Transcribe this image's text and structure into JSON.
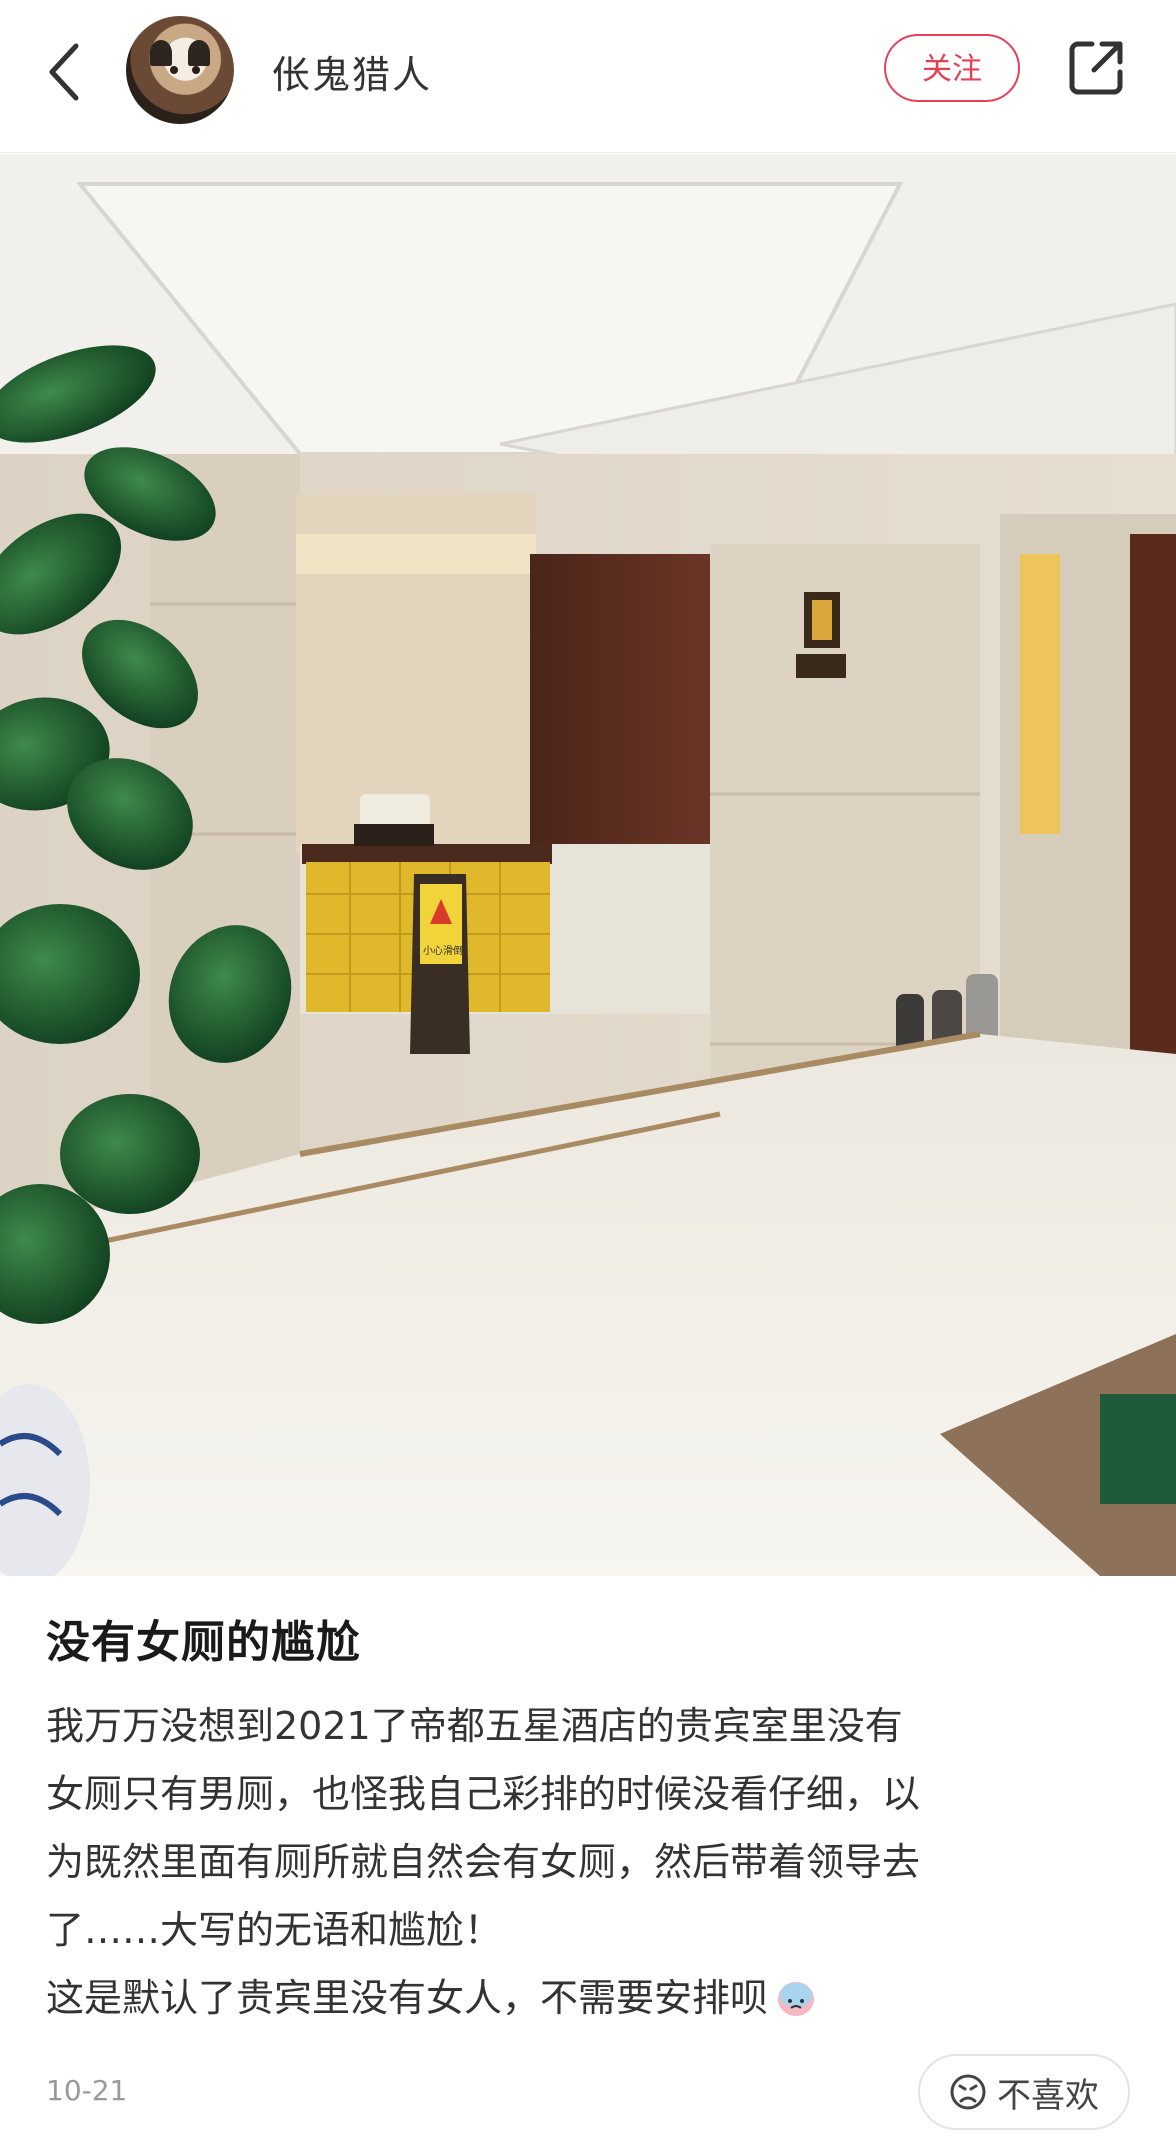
{
  "header": {
    "username": "伥鬼猎人",
    "follow_label": "关注"
  },
  "photo": {
    "sign_text": "小心滑倒"
  },
  "post": {
    "title": "没有女厕的尴尬",
    "body": "我万万没想到2021了帝都五星酒店的贵宾室里没有\n女厕只有男厕，也怪我自己彩排的时候没看仔细，以\n为既然里面有厕所就自然会有女厕，然后带着领导去\n了……大写的无语和尴尬！\n这是默认了贵宾里没有女人，不需要安排呗",
    "date": "10-21",
    "dislike_label": "不喜欢"
  }
}
